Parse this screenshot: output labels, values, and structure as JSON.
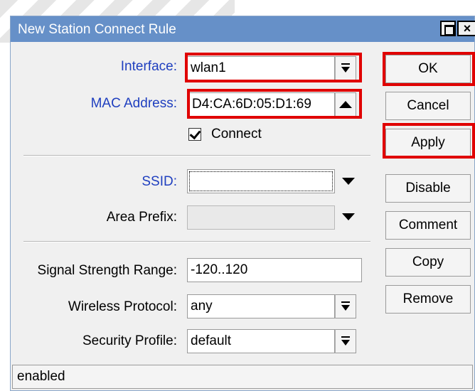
{
  "window": {
    "title": "New Station Connect Rule",
    "maximize_icon": "maximize-icon",
    "close_icon": "close-icon"
  },
  "form": {
    "interface": {
      "label": "Interface:",
      "value": "wlan1"
    },
    "mac_address": {
      "label": "MAC Address:",
      "value": "D4:CA:6D:05:D1:69"
    },
    "connect": {
      "label": "Connect",
      "checked": true
    },
    "ssid": {
      "label": "SSID:",
      "value": ""
    },
    "area_prefix": {
      "label": "Area Prefix:",
      "value": ""
    },
    "signal_strength_range": {
      "label": "Signal Strength Range:",
      "value": "-120..120"
    },
    "wireless_protocol": {
      "label": "Wireless Protocol:",
      "value": "any"
    },
    "security_profile": {
      "label": "Security Profile:",
      "value": "default"
    }
  },
  "buttons": {
    "ok": "OK",
    "cancel": "Cancel",
    "apply": "Apply",
    "disable": "Disable",
    "comment": "Comment",
    "copy": "Copy",
    "remove": "Remove"
  },
  "status": {
    "text": "enabled"
  },
  "colors": {
    "titlebar": "#6690c8",
    "highlight": "#e00000",
    "label_accent": "#1f3fbf"
  }
}
